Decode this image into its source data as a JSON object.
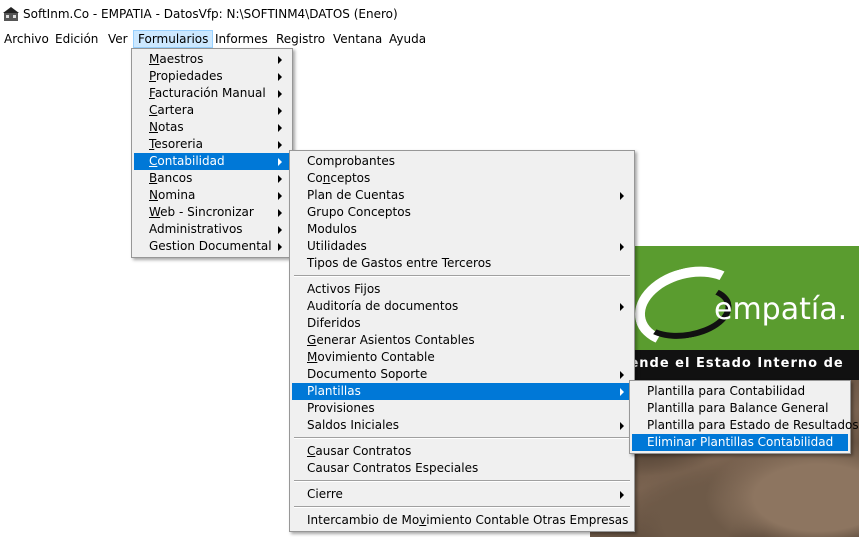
{
  "window": {
    "title": "SoftInm.Co - EMPATIA - DatosVfp: N:\\SOFTINM4\\DATOS  (Enero)"
  },
  "menubar": [
    "Archivo",
    "Edición",
    "Ver",
    "Formularios",
    "Informes",
    "Registro",
    "Ventana",
    "Ayuda"
  ],
  "menu_formularios": {
    "items": [
      {
        "label": "Maestros",
        "u": "M",
        "rest": "aestros",
        "submenu": true
      },
      {
        "label": "Propiedades",
        "u": "P",
        "rest": "ropiedades",
        "submenu": true
      },
      {
        "label": "Facturación Manual",
        "u": "F",
        "rest": "acturación Manual",
        "submenu": true
      },
      {
        "label": "Cartera",
        "u": "C",
        "rest": "artera",
        "submenu": true
      },
      {
        "label": "Notas",
        "u": "N",
        "rest": "otas",
        "submenu": true
      },
      {
        "label": "Tesoreria",
        "u": "T",
        "rest": "esoreria",
        "submenu": true
      },
      {
        "label": "Contabilidad",
        "u": "C",
        "rest": "ontabilidad",
        "submenu": true,
        "selected": true
      },
      {
        "label": "Bancos",
        "u": "B",
        "rest": "ancos",
        "submenu": true
      },
      {
        "label": "Nomina",
        "u": "N",
        "rest": "omina",
        "submenu": true
      },
      {
        "label": "Web - Sincronizar",
        "u": "W",
        "rest": "eb - Sincronizar",
        "submenu": true
      },
      {
        "label": "Administrativos",
        "u": "",
        "rest": "Administrativos",
        "submenu": true
      },
      {
        "label": "Gestion Documental",
        "u": "",
        "rest": "Gestion Documental",
        "submenu": true
      }
    ]
  },
  "menu_contabilidad": {
    "items": [
      {
        "pre": "",
        "u": "",
        "rest": "Comprobantes",
        "submenu": false
      },
      {
        "pre": "Co",
        "u": "n",
        "rest": "ceptos",
        "submenu": false
      },
      {
        "pre": "",
        "u": "",
        "rest": "Plan de Cuentas",
        "submenu": true
      },
      {
        "pre": "",
        "u": "",
        "rest": "Grupo Conceptos",
        "submenu": false
      },
      {
        "pre": "",
        "u": "",
        "rest": "Modulos",
        "submenu": false
      },
      {
        "pre": "",
        "u": "",
        "rest": "Utilidades",
        "submenu": true
      },
      {
        "pre": "",
        "u": "",
        "rest": "Tipos de Gastos entre Terceros",
        "submenu": false
      },
      {
        "sep": true
      },
      {
        "pre": "",
        "u": "",
        "rest": "Activos Fijos",
        "submenu": false
      },
      {
        "pre": "",
        "u": "",
        "rest": "Auditoría de documentos",
        "submenu": true
      },
      {
        "pre": "",
        "u": "",
        "rest": "Diferidos",
        "submenu": false
      },
      {
        "pre": "",
        "u": "G",
        "rest": "enerar Asientos Contables",
        "submenu": false
      },
      {
        "pre": "",
        "u": "M",
        "rest": "ovimiento Contable",
        "submenu": false
      },
      {
        "pre": "",
        "u": "",
        "rest": "Documento Soporte",
        "submenu": true
      },
      {
        "pre": "",
        "u": "",
        "rest": "Plantillas",
        "submenu": true,
        "selected": true
      },
      {
        "pre": "",
        "u": "",
        "rest": "Provisiones",
        "submenu": false
      },
      {
        "pre": "",
        "u": "",
        "rest": "Saldos Iniciales",
        "submenu": true
      },
      {
        "sep": true
      },
      {
        "pre": "",
        "u": "C",
        "rest": "ausar Contratos",
        "submenu": false
      },
      {
        "pre": "",
        "u": "",
        "rest": "Causar Contratos Especiales",
        "submenu": false
      },
      {
        "sep": true
      },
      {
        "pre": "",
        "u": "",
        "rest": "Cierre",
        "submenu": true
      },
      {
        "sep": true
      },
      {
        "pre": "Intercambio de Mo",
        "u": "v",
        "rest": "imiento Contable Otras Empresas",
        "submenu": false
      }
    ]
  },
  "menu_plantillas": {
    "items": [
      {
        "label": "Plantilla para Contabilidad"
      },
      {
        "label": "Plantilla para Balance General"
      },
      {
        "label": "Plantilla para Estado de Resultados"
      },
      {
        "label": "Eliminar Plantillas Contabilidad",
        "selected": true
      }
    ]
  },
  "banner": {
    "brand": "empatía.",
    "slogan": "iende el Estado Interno de"
  },
  "colors": {
    "highlight": "#0078d7",
    "menu_bg": "#f0f0f0",
    "banner_green": "#5a9c2f"
  }
}
